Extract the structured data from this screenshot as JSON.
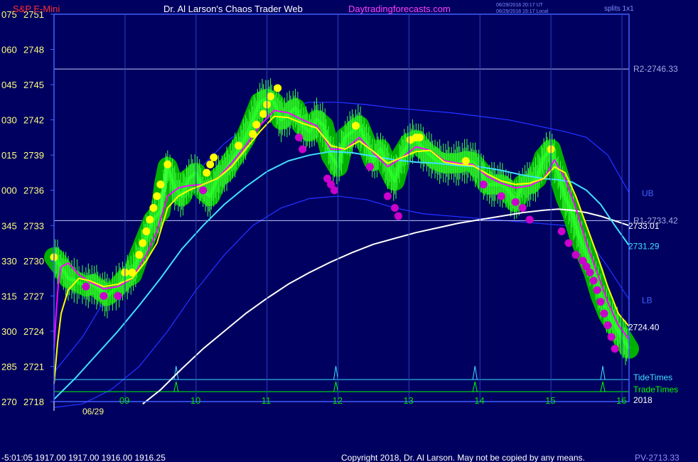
{
  "header": {
    "symbol": "S&P E-Mini",
    "site_title": "Dr. Al Larson's Chaos Trader Web",
    "site_url": "Daytradingforecasts.com",
    "time_utc": "06/29/2018 20:17 UT",
    "time_local": "06/29/2018 15:17 Local",
    "splits_label": "splits 1x1"
  },
  "footer": {
    "status_line": "-5:01:05  1917.00 1917.00 1916.00 1916.25",
    "copyright": "Copyright 2018, Dr. Al Larson. May not be copied by any means.",
    "pv_label": "PV-2713.33"
  },
  "colors": {
    "background": "#000060",
    "frame": "#4060ff",
    "price": "#00ff00",
    "halo": "#00b000",
    "yellow_line": "#ffff00",
    "magenta_line": "#ff00ff",
    "cyan_line": "#40e0ff",
    "white_line": "#ffffff",
    "bands": "#2030ff",
    "high_dot": "#ffff00",
    "low_dot": "#cc00cc",
    "axis_text": "#ffff80",
    "hours_text": "#00e000"
  },
  "chart_data": {
    "type": "line",
    "y_axis": {
      "min": 2718,
      "max": 2751,
      "ylim": [
        2718,
        2751
      ],
      "ticks": [
        {
          "left": "075",
          "price": "2751",
          "value": 2751
        },
        {
          "left": "060",
          "price": "2748",
          "value": 2748
        },
        {
          "left": "045",
          "price": "2745",
          "value": 2745
        },
        {
          "left": "030",
          "price": "2742",
          "value": 2742
        },
        {
          "left": "015",
          "price": "2739",
          "value": 2739
        },
        {
          "left": "000",
          "price": "2736",
          "value": 2736
        },
        {
          "left": "345",
          "price": "2733",
          "value": 2733
        },
        {
          "left": "330",
          "price": "2730",
          "value": 2730
        },
        {
          "left": "315",
          "price": "2727",
          "value": 2727
        },
        {
          "left": "300",
          "price": "2724",
          "value": 2724
        },
        {
          "left": "285",
          "price": "2721",
          "value": 2721
        },
        {
          "left": "270",
          "price": "2718",
          "value": 2718
        }
      ]
    },
    "x_axis": {
      "min": 8.0,
      "max": 16.1,
      "hour_ticks": [
        "09",
        "10",
        "11",
        "12",
        "13",
        "14",
        "15",
        "16"
      ],
      "hour_values": [
        9,
        10,
        11,
        12,
        13,
        14,
        15,
        16
      ],
      "date_label": "06/29",
      "year_label": "2018"
    },
    "levels": [
      {
        "name": "R2-2746.33",
        "value": 2746.33
      },
      {
        "name": "R1-2733.42",
        "value": 2733.42
      }
    ],
    "right_labels": [
      {
        "text": "UB",
        "value": 2735.8
      },
      {
        "text": "2733.01",
        "value": 2733.01
      },
      {
        "text": "2731.29",
        "value": 2731.29
      },
      {
        "text": "LB",
        "value": 2726.7
      },
      {
        "text": "2724.40",
        "value": 2724.4
      }
    ],
    "event_lines": {
      "tide_label": "TideTimes",
      "trade_label": "TradeTimes",
      "tide_times": [
        9.72,
        11.97,
        13.93,
        15.73
      ],
      "trade_times": [
        9.72,
        11.97,
        13.93,
        15.73
      ]
    },
    "series": [
      {
        "name": "price",
        "x": [
          8.0,
          8.1,
          8.2,
          8.3,
          8.45,
          8.55,
          8.65,
          8.75,
          8.9,
          9.0,
          9.1,
          9.2,
          9.3,
          9.4,
          9.5,
          9.55,
          9.6,
          9.7,
          9.8,
          9.9,
          10.0,
          10.1,
          10.2,
          10.3,
          10.4,
          10.5,
          10.6,
          10.7,
          10.8,
          10.9,
          11.0,
          11.1,
          11.2,
          11.3,
          11.4,
          11.5,
          11.6,
          11.7,
          11.8,
          11.9,
          12.0,
          12.1,
          12.2,
          12.3,
          12.4,
          12.5,
          12.6,
          12.7,
          12.8,
          12.9,
          13.0,
          13.1,
          13.2,
          13.3,
          13.4,
          13.5,
          13.6,
          13.7,
          13.8,
          13.9,
          14.0,
          14.1,
          14.2,
          14.3,
          14.4,
          14.5,
          14.6,
          14.7,
          14.8,
          14.9,
          15.0,
          15.1,
          15.2,
          15.3,
          15.4,
          15.5,
          15.6,
          15.7,
          15.8,
          15.9,
          16.0,
          16.1
        ],
        "values": [
          2730.3,
          2729.5,
          2728.5,
          2728.3,
          2727.8,
          2728.0,
          2727.5,
          2727.0,
          2727.8,
          2728.5,
          2728.8,
          2730.5,
          2732.0,
          2733.5,
          2734.2,
          2736.5,
          2738.0,
          2736.2,
          2735.5,
          2737.0,
          2737.5,
          2736.0,
          2735.5,
          2737.0,
          2737.5,
          2738.5,
          2739.5,
          2740.5,
          2742.0,
          2743.5,
          2743.8,
          2743.5,
          2742.0,
          2742.5,
          2743.0,
          2741.5,
          2741.0,
          2742.0,
          2741.5,
          2739.0,
          2738.0,
          2740.5,
          2741.0,
          2741.5,
          2740.0,
          2738.5,
          2739.5,
          2738.0,
          2736.8,
          2739.0,
          2740.0,
          2740.3,
          2739.5,
          2739.0,
          2738.5,
          2738.3,
          2738.3,
          2738.3,
          2738.5,
          2738.4,
          2737.7,
          2736.5,
          2736.5,
          2736.5,
          2736.0,
          2735.0,
          2736.5,
          2736.5,
          2737.0,
          2738.8,
          2739.5,
          2737.5,
          2735.5,
          2734.0,
          2732.0,
          2730.5,
          2729.0,
          2727.0,
          2725.5,
          2724.5,
          2723.5,
          2722.5
        ]
      },
      {
        "name": "yellow",
        "x": [
          8.0,
          8.05,
          8.1,
          8.2,
          8.35,
          8.5,
          8.7,
          8.9,
          9.1,
          9.3,
          9.45,
          9.6,
          9.75,
          9.9,
          10.1,
          10.3,
          10.5,
          10.7,
          10.9,
          11.1,
          11.3,
          11.5,
          11.7,
          11.9,
          12.1,
          12.3,
          12.5,
          12.7,
          12.9,
          13.1,
          13.3,
          13.5,
          13.7,
          13.9,
          14.1,
          14.3,
          14.5,
          14.7,
          14.9,
          15.05,
          15.2,
          15.35,
          15.5,
          15.65,
          15.8,
          15.95,
          16.1
        ],
        "values": [
          2719.5,
          2723.0,
          2725.5,
          2727.5,
          2728.5,
          2728.3,
          2727.8,
          2728.0,
          2728.5,
          2730.0,
          2731.5,
          2734.5,
          2735.5,
          2736.0,
          2736.5,
          2737.0,
          2738.0,
          2739.5,
          2741.0,
          2742.3,
          2742.2,
          2741.7,
          2741.3,
          2739.8,
          2739.5,
          2740.2,
          2739.3,
          2738.3,
          2738.8,
          2739.3,
          2739.4,
          2738.4,
          2738.2,
          2738.1,
          2737.4,
          2736.8,
          2736.5,
          2736.6,
          2737.0,
          2738.0,
          2737.5,
          2735.5,
          2733.0,
          2730.5,
          2727.8,
          2725.5,
          2724.4
        ]
      },
      {
        "name": "magenta",
        "x": [
          8.0,
          8.03,
          8.06,
          8.1,
          8.2,
          8.35,
          8.5,
          8.7,
          8.9,
          9.1,
          9.3,
          9.45,
          9.6,
          9.75,
          9.9,
          10.1,
          10.3,
          10.5,
          10.7,
          10.9,
          11.1,
          11.3,
          11.5,
          11.7,
          11.9,
          12.1,
          12.3,
          12.5,
          12.7,
          12.9,
          13.1,
          13.3,
          13.5,
          13.7,
          13.9,
          14.1,
          14.3,
          14.5,
          14.7,
          14.9,
          15.05,
          15.2,
          15.35,
          15.5,
          15.65,
          15.8,
          15.95,
          16.1
        ],
        "values": [
          2722.5,
          2725.5,
          2728.0,
          2729.5,
          2729.8,
          2728.8,
          2728.2,
          2727.6,
          2727.8,
          2728.5,
          2730.5,
          2732.5,
          2735.5,
          2736.2,
          2736.4,
          2736.5,
          2737.0,
          2738.3,
          2739.8,
          2741.5,
          2742.8,
          2742.6,
          2742.0,
          2741.5,
          2739.5,
          2739.5,
          2740.5,
          2739.2,
          2738.0,
          2738.8,
          2739.7,
          2739.4,
          2738.5,
          2738.3,
          2738.2,
          2737.2,
          2736.6,
          2736.2,
          2736.4,
          2737.0,
          2738.6,
          2737.0,
          2734.5,
          2731.5,
          2729.0,
          2726.5,
          2724.5,
          2723.3
        ]
      },
      {
        "name": "cyan",
        "x": [
          8.0,
          8.3,
          8.6,
          8.9,
          9.2,
          9.5,
          9.8,
          10.1,
          10.4,
          10.7,
          11.0,
          11.3,
          11.6,
          11.9,
          12.2,
          12.5,
          12.8,
          13.1,
          13.4,
          13.7,
          14.0,
          14.3,
          14.6,
          14.9,
          15.1,
          15.3,
          15.5,
          15.7,
          15.9,
          16.1
        ],
        "values": [
          2718.2,
          2720.0,
          2722.0,
          2724.0,
          2726.2,
          2728.5,
          2731.0,
          2733.0,
          2734.8,
          2736.3,
          2737.6,
          2738.5,
          2739.0,
          2739.3,
          2739.2,
          2738.9,
          2738.6,
          2738.4,
          2738.3,
          2738.1,
          2738.0,
          2737.7,
          2737.3,
          2737.0,
          2736.9,
          2736.7,
          2736.0,
          2734.8,
          2733.0,
          2731.3
        ]
      },
      {
        "name": "white",
        "x": [
          9.25,
          9.5,
          9.8,
          10.1,
          10.4,
          10.7,
          11.0,
          11.3,
          11.6,
          11.9,
          12.2,
          12.5,
          12.8,
          13.1,
          13.4,
          13.7,
          14.0,
          14.3,
          14.6,
          14.9,
          15.1,
          15.3,
          15.5,
          15.7,
          15.9,
          16.1
        ],
        "values": [
          2717.8,
          2719.0,
          2720.8,
          2722.5,
          2724.0,
          2725.5,
          2726.8,
          2728.0,
          2729.0,
          2729.9,
          2730.7,
          2731.4,
          2731.9,
          2732.4,
          2732.8,
          2733.2,
          2733.5,
          2733.8,
          2734.1,
          2734.3,
          2734.4,
          2734.3,
          2734.1,
          2733.8,
          2733.4,
          2733.0
        ]
      },
      {
        "name": "upper-band",
        "x": [
          8.0,
          8.4,
          8.8,
          9.2,
          9.6,
          10.0,
          10.4,
          10.8,
          11.2,
          11.6,
          12.0,
          12.4,
          12.8,
          13.2,
          13.6,
          14.0,
          14.4,
          14.8,
          15.2,
          15.5,
          15.8,
          16.1
        ],
        "values": [
          2720.5,
          2723.5,
          2727.5,
          2731.0,
          2734.5,
          2737.5,
          2740.0,
          2741.8,
          2743.0,
          2743.5,
          2743.5,
          2743.3,
          2743.0,
          2742.8,
          2742.6,
          2742.3,
          2742.0,
          2741.5,
          2741.0,
          2740.5,
          2739.0,
          2735.8
        ]
      },
      {
        "name": "lower-band",
        "x": [
          8.0,
          8.4,
          8.8,
          9.2,
          9.6,
          10.0,
          10.4,
          10.8,
          11.2,
          11.6,
          12.0,
          12.4,
          12.8,
          13.2,
          13.6,
          14.0,
          14.4,
          14.8,
          15.2,
          15.5,
          15.8,
          16.1
        ],
        "values": [
          2717.5,
          2717.8,
          2719.0,
          2721.0,
          2724.0,
          2727.5,
          2730.5,
          2733.0,
          2734.5,
          2735.3,
          2735.5,
          2735.2,
          2734.5,
          2734.0,
          2733.8,
          2733.6,
          2733.4,
          2733.2,
          2733.0,
          2732.0,
          2729.5,
          2726.7
        ]
      }
    ],
    "high_dots": {
      "x": [
        8.0,
        9.0,
        9.1,
        9.2,
        9.25,
        9.3,
        9.35,
        9.4,
        9.45,
        9.5,
        9.6,
        10.15,
        10.2,
        10.25,
        10.6,
        10.8,
        10.85,
        10.95,
        11.0,
        11.05,
        11.15,
        12.25,
        13.02,
        13.1,
        13.15,
        13.8,
        15.0
      ],
      "values": [
        2730.3,
        2729.0,
        2729.0,
        2730.5,
        2731.5,
        2732.5,
        2733.5,
        2734.5,
        2735.5,
        2736.5,
        2738.2,
        2737.5,
        2738.2,
        2738.8,
        2739.8,
        2740.8,
        2741.6,
        2742.5,
        2743.3,
        2744.0,
        2744.7,
        2741.5,
        2740.3,
        2740.5,
        2740.5,
        2738.5,
        2739.5
      ]
    },
    "low_dots": {
      "x": [
        8.45,
        8.7,
        8.9,
        10.1,
        11.45,
        11.5,
        11.85,
        11.9,
        11.95,
        12.45,
        12.7,
        12.8,
        12.85,
        14.05,
        14.3,
        14.5,
        14.6,
        14.7,
        15.15,
        15.25,
        15.35,
        15.45,
        15.5,
        15.55,
        15.6,
        15.65,
        15.7,
        15.75,
        15.8,
        15.85,
        15.9
      ],
      "values": [
        2727.8,
        2727.0,
        2727.0,
        2736.0,
        2740.5,
        2739.5,
        2737.0,
        2736.5,
        2736.0,
        2738.0,
        2735.5,
        2734.5,
        2733.8,
        2736.5,
        2735.5,
        2735.0,
        2734.5,
        2733.5,
        2732.5,
        2731.5,
        2730.5,
        2730.0,
        2729.5,
        2729.0,
        2728.3,
        2727.5,
        2726.5,
        2725.5,
        2724.5,
        2723.5,
        2722.5
      ]
    }
  }
}
